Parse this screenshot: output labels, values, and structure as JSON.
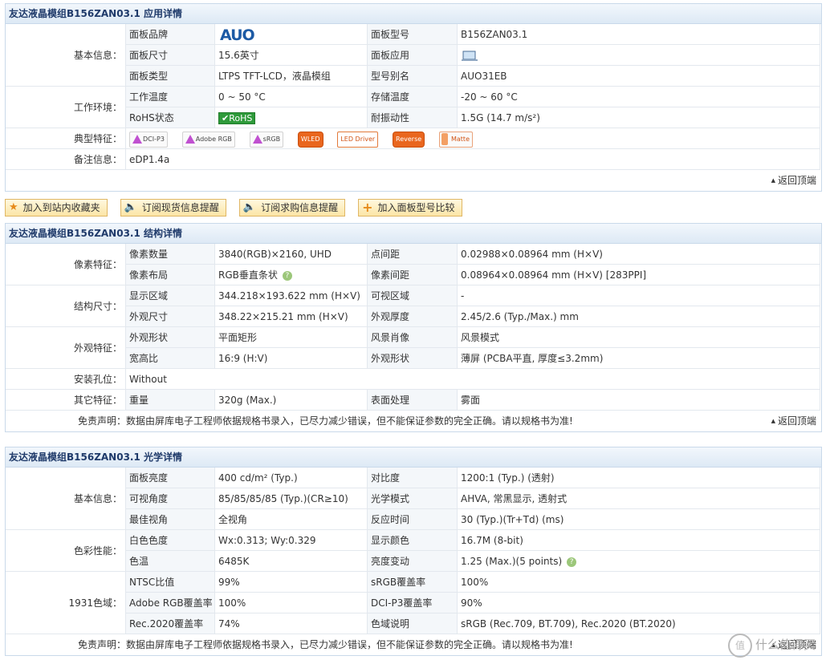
{
  "section1": {
    "title": "友达液晶模组B156ZAN03.1 应用详情",
    "basic_label": "基本信息：",
    "env_label": "工作环境：",
    "feature_label": "典型特征：",
    "note_label": "备注信息：",
    "rows": {
      "brand_label": "面板品牌",
      "brand_logo": "AUO",
      "model_label": "面板型号",
      "model_value": "B156ZAN03.1",
      "size_label": "面板尺寸",
      "size_value": "15.6英寸",
      "app_label": "面板应用",
      "type_label": "面板类型",
      "type_value": "LTPS TFT-LCD，液晶模组",
      "alias_label": "型号别名",
      "alias_value": "AUO31EB",
      "op_temp_label": "工作温度",
      "op_temp_value": "0 ~ 50 °C",
      "st_temp_label": "存储温度",
      "st_temp_value": "-20 ~ 60 °C",
      "rohs_label": "RoHS状态",
      "rohs_value": "RoHS",
      "vib_label": "耐振动性",
      "vib_value": "1.5G (14.7 m/s²)",
      "note_value": "eDP1.4a"
    },
    "badges": [
      "DCI-P3",
      "Adobe RGB",
      "sRGB",
      "WLED",
      "LED Driver",
      "Reverse",
      "Matte"
    ],
    "back_top": "返回顶端"
  },
  "actions": [
    "加入到站内收藏夹",
    "订阅现货信息提醒",
    "订阅求购信息提醒",
    "加入面板型号比较"
  ],
  "section2": {
    "title": "友达液晶模组B156ZAN03.1 结构详情",
    "cat_pixel": "像素特征：",
    "cat_struct": "结构尺寸：",
    "cat_look": "外观特征：",
    "cat_mount": "安装孔位：",
    "cat_other": "其它特征：",
    "px_count_label": "像素数量",
    "px_count_value": "3840(RGB)×2160, UHD",
    "dot_pitch_label": "点间距",
    "dot_pitch_value": "0.02988×0.08964 mm (H×V)",
    "px_layout_label": "像素布局",
    "px_layout_value": "RGB垂直条状",
    "px_pitch_label": "像素间距",
    "px_pitch_value": "0.08964×0.08964 mm (H×V)  [283PPI]",
    "disp_area_label": "显示区域",
    "disp_area_value": "344.218×193.622 mm (H×V)",
    "vis_area_label": "可视区域",
    "vis_area_value": "-",
    "outline_label": "外观尺寸",
    "outline_value": "348.22×215.21 mm (H×V)",
    "thick_label": "外观厚度",
    "thick_value": "2.45/2.6 (Typ./Max.) mm",
    "shape_label": "外观形状",
    "shape_value": "平面矩形",
    "orient_label": "风景肖像",
    "orient_value": "风景模式",
    "ratio_label": "宽高比",
    "ratio_value": "16:9 (H:V)",
    "shape2_label": "外观形状",
    "shape2_value": "薄屏 (PCBA平直, 厚度≤3.2mm)",
    "mount_value": "Without",
    "weight_label": "重量",
    "weight_value": "320g (Max.)",
    "surface_label": "表面处理",
    "surface_value": "雾面",
    "disclaimer": "免责声明：数据由屏库电子工程师依据规格书录入，已尽力减少错误，但不能保证参数的完全正确。请以规格书为准!",
    "back_top": "返回顶端"
  },
  "section3": {
    "title": "友达液晶模组B156ZAN03.1 光学详情",
    "cat_basic": "基本信息：",
    "cat_color": "色彩性能：",
    "cat_gamut": "1931色域：",
    "bright_label": "面板亮度",
    "bright_value": "400 cd/m² (Typ.)",
    "contrast_label": "对比度",
    "contrast_value": "1200:1 (Typ.) (透射)",
    "angle_label": "可视角度",
    "angle_value": "85/85/85/85 (Typ.)(CR≥10)",
    "mode_label": "光学模式",
    "mode_value": "AHVA, 常黑显示, 透射式",
    "best_label": "最佳视角",
    "best_value": "全视角",
    "resp_label": "反应时间",
    "resp_value": "30 (Typ.)(Tr+Td) (ms)",
    "white_label": "白色色度",
    "white_value": "Wx:0.313; Wy:0.329",
    "colors_label": "显示颜色",
    "colors_value": "16.7M (8-bit)",
    "temp_label": "色温",
    "temp_value": "6485K",
    "uni_label": "亮度变动",
    "uni_value": "1.25 (Max.)(5 points)",
    "ntsc_label": "NTSC比值",
    "ntsc_value": "99%",
    "srgb_label": "sRGB覆盖率",
    "srgb_value": "100%",
    "adobe_label": "Adobe RGB覆盖率",
    "adobe_value": "100%",
    "dci_label": "DCI-P3覆盖率",
    "dci_value": "90%",
    "rec_label": "Rec.2020覆盖率",
    "rec_value": "74%",
    "gamut_label": "色域说明",
    "gamut_value": "sRGB (Rec.709, BT.709), Rec.2020 (BT.2020)",
    "disclaimer": "免责声明：数据由屏库电子工程师依据规格书录入，已尽力减少错误，但不能保证参数的完全正确。请以规格书为准!",
    "back_top": "返回顶端"
  },
  "watermark": "什么值得买",
  "watermark_icon": "值"
}
